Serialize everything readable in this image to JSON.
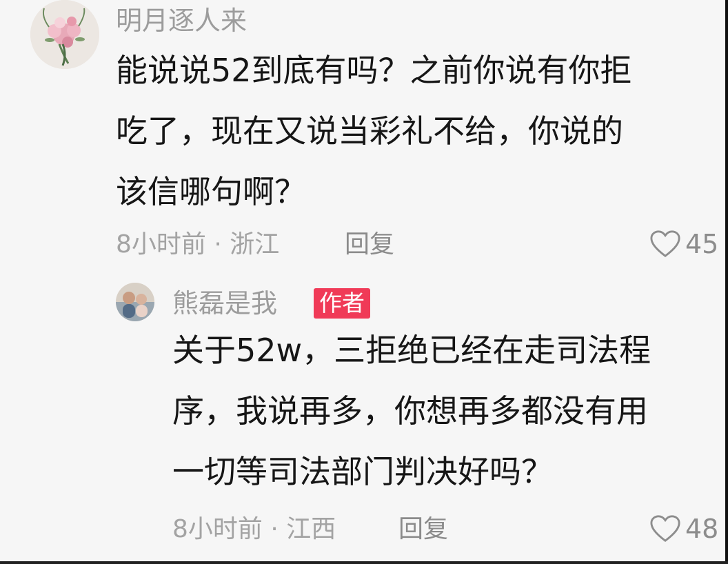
{
  "comments": [
    {
      "username": "明月逐人来",
      "content_lines": [
        "能说说52到底有吗？之前你说有你拒",
        "吃了，现在又说当彩礼不给，你说的",
        "该信哪句啊？"
      ],
      "meta": "8小时前 · 浙江",
      "reply_label": "回复",
      "like_count": "45",
      "avatar_icon": "flower-bouquet-avatar"
    },
    {
      "username": "熊磊是我",
      "badge": "作者",
      "content_lines": [
        "关于52w，三拒绝已经在走司法程",
        "序，我说再多，你想再多都没有用",
        "一切等司法部门判决好吗？"
      ],
      "meta": "8小时前 · 江西",
      "reply_label": "回复",
      "like_count": "48",
      "avatar_icon": "couple-photo-avatar"
    }
  ],
  "colors": {
    "background": "#f6f6f6",
    "text": "#161616",
    "muted": "#9c9c9c",
    "badge": "#f03a57"
  }
}
